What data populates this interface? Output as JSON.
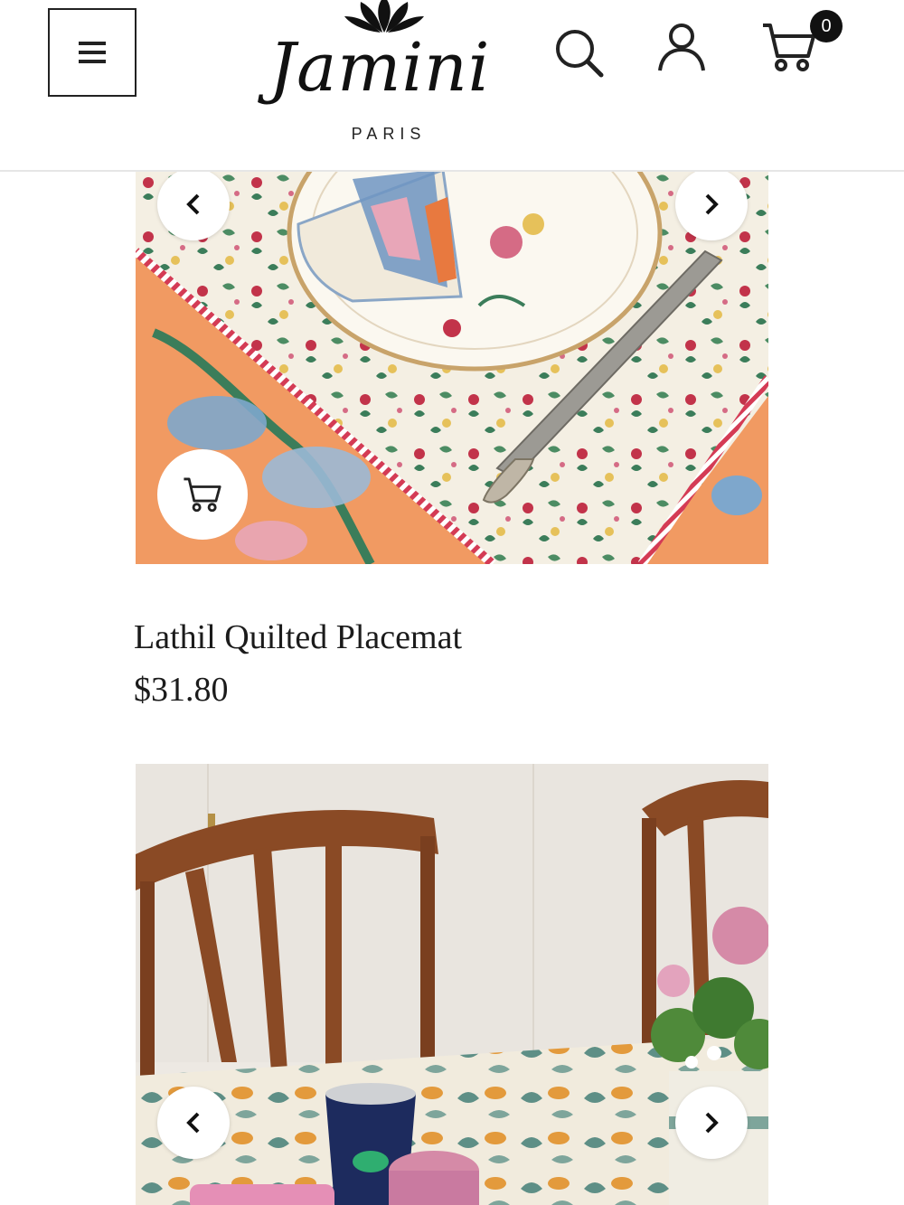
{
  "header": {
    "brand": "Jamini",
    "brand_sub": "PARIS",
    "cart_count": "0",
    "icons": {
      "menu": "hamburger-menu-icon",
      "search": "search-icon",
      "account": "user-icon",
      "cart": "cart-icon"
    }
  },
  "products": [
    {
      "name": "Lathil Quilted Placemat",
      "price": "$31.80",
      "image": "placemat-photo"
    },
    {
      "image": "dining-table-photo"
    }
  ],
  "colors": {
    "text": "#1b1b1b",
    "orange": "#f19a62",
    "cream": "#f4efe3",
    "green": "#3b7d5a",
    "wood": "#8a4a25",
    "pink": "#e8a6b8"
  }
}
